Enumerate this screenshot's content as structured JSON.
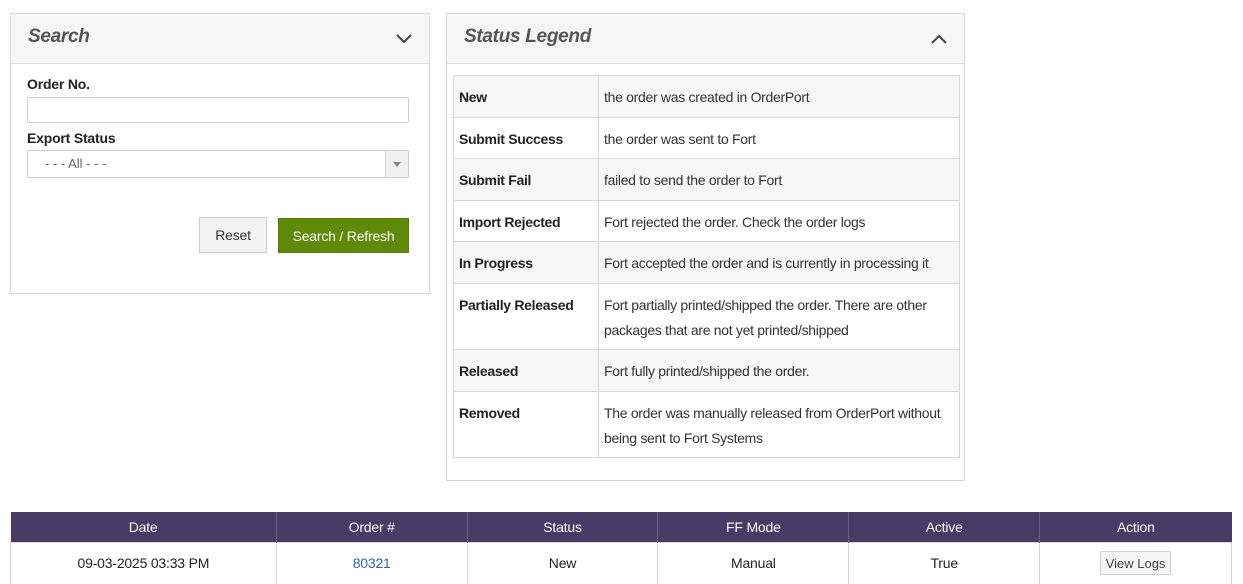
{
  "search": {
    "title": "Search",
    "order_no_label": "Order No.",
    "order_no_value": "",
    "export_status_label": "Export Status",
    "export_status_value": "- - - All - - -",
    "reset_label": "Reset",
    "search_label": "Search / Refresh"
  },
  "legend": {
    "title": "Status Legend",
    "rows": [
      {
        "term": "New",
        "desc": "the order was created in OrderPort"
      },
      {
        "term": "Submit Success",
        "desc": "the order was sent to Fort"
      },
      {
        "term": "Submit Fail",
        "desc": "failed to send the order to Fort"
      },
      {
        "term": "Import Rejected",
        "desc": "Fort rejected the order. Check the order logs"
      },
      {
        "term": "In Progress",
        "desc": "Fort accepted the order and is currently in processing it"
      },
      {
        "term": "Partially Released",
        "desc": "Fort partially printed/shipped the order. There are other packages that are not yet printed/shipped"
      },
      {
        "term": "Released",
        "desc": "Fort fully printed/shipped the order."
      },
      {
        "term": "Removed",
        "desc": "The order was manually released from OrderPort without being sent to Fort Systems"
      }
    ]
  },
  "grid": {
    "headers": [
      "Date",
      "Order #",
      "Status",
      "FF Mode",
      "Active",
      "Action"
    ],
    "rows": [
      {
        "date": "09-03-2025 03:33 PM",
        "order": "80321",
        "status": "New",
        "ff_mode": "Manual",
        "active": "True",
        "action": "View Logs"
      }
    ]
  },
  "colors": {
    "header_purple": "#4a3a66",
    "primary_green": "#5e8a08",
    "link_blue": "#2a6aa8"
  }
}
